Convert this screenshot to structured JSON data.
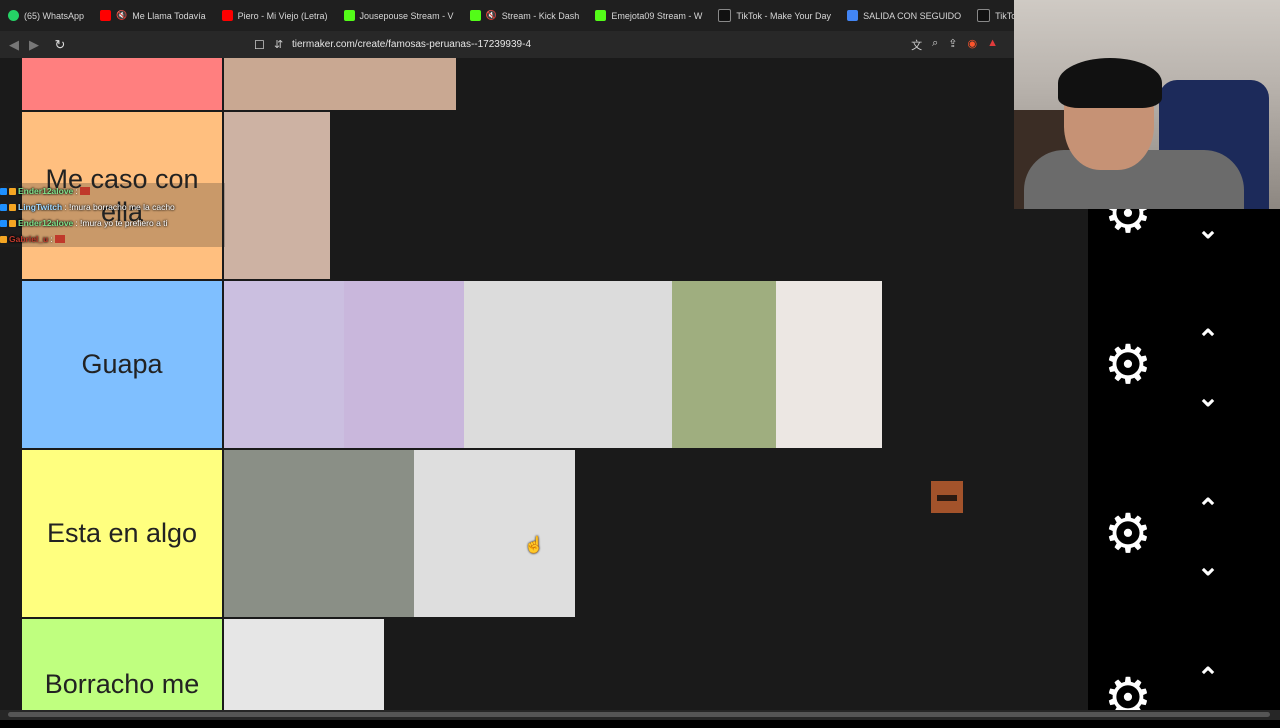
{
  "bookmarks": [
    {
      "icon": "whatsapp-icon",
      "label": "(65) WhatsApp"
    },
    {
      "icon": "youtube-icon",
      "label": "Me Llama Todavía",
      "muted": true
    },
    {
      "icon": "youtube-icon",
      "label": "Piero - Mi Viejo (Letra)"
    },
    {
      "icon": "kick-icon",
      "label": "Jousepouse Stream - V"
    },
    {
      "icon": "kick-icon",
      "label": "Stream - Kick Dash",
      "muted": true
    },
    {
      "icon": "kick-icon",
      "label": "Emejota09 Stream - W"
    },
    {
      "icon": "tiktok-icon",
      "label": "TikTok - Make Your Day"
    },
    {
      "icon": "docs-icon",
      "label": "SALIDA CON SEGUIDO"
    },
    {
      "icon": "tiktok-icon",
      "label": "TikTok - Make Your Da"
    }
  ],
  "address": {
    "url": "tiermaker.com/create/famosas-peruanas--17239939-4"
  },
  "icons": {
    "back": "◀",
    "forward": "▶",
    "reload": "↻",
    "bookmark": "☐",
    "site": "⇵",
    "translate": "文",
    "zoom": "⌕",
    "share": "⇪",
    "brave": "◉",
    "warn": "▲",
    "gear": "⚙",
    "chev_up": "⌃",
    "chev_down": "⌄",
    "mute": "🔇"
  },
  "tiers": [
    {
      "label": "",
      "color": "#ff7f7f",
      "images": [
        {
          "color": "#c9a892"
        }
      ]
    },
    {
      "label": "Me caso con ella",
      "color": "#ffbf7f",
      "images": [
        {
          "color": "#cdb2a3"
        }
      ]
    },
    {
      "label": "Guapa",
      "color": "#7fbfff",
      "images": [
        {
          "color": "#cbbfe0"
        },
        {
          "color": "#c9b7dc"
        },
        {
          "color": "#dcdcdc"
        },
        {
          "color": "#9fae7f"
        },
        {
          "color": "#ece7e3"
        }
      ]
    },
    {
      "label": "Esta en algo",
      "color": "#ffff7f",
      "images": [
        {
          "color": "#8a8f86"
        },
        {
          "color": "#dedede"
        }
      ]
    },
    {
      "label": "Borracho me",
      "color": "#bfff7f",
      "images": [
        {
          "color": "#e6e6e6"
        }
      ]
    }
  ],
  "chat": [
    {
      "user": "Ender12alove",
      "message": " :"
    },
    {
      "user": "LingTwitch",
      "message": " : !mura borracho me la cacho"
    },
    {
      "user": "Ender12alove",
      "message": " : !mura yo te prefiero a ti"
    },
    {
      "user": "Gabriel_u",
      "message": " :"
    }
  ]
}
